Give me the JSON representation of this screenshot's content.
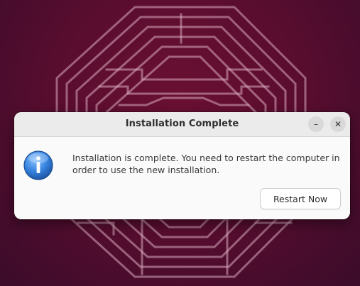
{
  "dialog": {
    "title": "Installation Complete",
    "message": "Installation is complete. You need to restart the computer in order to use the new installation.",
    "icon": "info-icon",
    "restart_label": "Restart Now",
    "minimize_symbol": "–",
    "close_symbol": "✕"
  },
  "colors": {
    "wallpaper": "#5a0d2f",
    "dialog_bg": "#fafafa",
    "titlebar_bg": "#ebebeb",
    "icon_blue": "#2f79d4"
  }
}
